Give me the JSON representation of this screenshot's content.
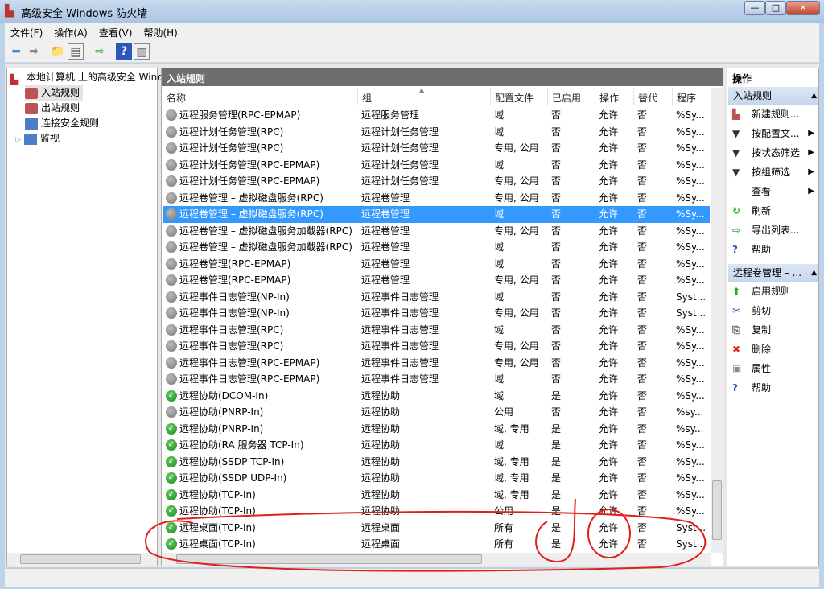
{
  "window": {
    "title": "高级安全 Windows 防火墙",
    "min": "—",
    "max": "□",
    "close": "✕"
  },
  "menu": [
    "文件(F)",
    "操作(A)",
    "查看(V)",
    "帮助(H)"
  ],
  "tree": {
    "root": "本地计算机 上的高级安全 Windows",
    "items": [
      "入站规则",
      "出站规则",
      "连接安全规则",
      "监视"
    ]
  },
  "center": {
    "title": "入站规则",
    "columns": [
      "名称",
      "组",
      "配置文件",
      "已启用",
      "操作",
      "替代",
      "程序"
    ],
    "rows": [
      [
        "远程服务管理(RPC-EPMAP)",
        "远程服务管理",
        "域",
        "否",
        "允许",
        "否",
        "%Sy...",
        false
      ],
      [
        "远程计划任务管理(RPC)",
        "远程计划任务管理",
        "域",
        "否",
        "允许",
        "否",
        "%Sy...",
        false
      ],
      [
        "远程计划任务管理(RPC)",
        "远程计划任务管理",
        "专用, 公用",
        "否",
        "允许",
        "否",
        "%Sy...",
        false
      ],
      [
        "远程计划任务管理(RPC-EPMAP)",
        "远程计划任务管理",
        "域",
        "否",
        "允许",
        "否",
        "%Sy...",
        false
      ],
      [
        "远程计划任务管理(RPC-EPMAP)",
        "远程计划任务管理",
        "专用, 公用",
        "否",
        "允许",
        "否",
        "%Sy...",
        false
      ],
      [
        "远程卷管理 – 虚拟磁盘服务(RPC)",
        "远程卷管理",
        "专用, 公用",
        "否",
        "允许",
        "否",
        "%Sy...",
        false
      ],
      [
        "远程卷管理 – 虚拟磁盘服务(RPC)",
        "远程卷管理",
        "域",
        "否",
        "允许",
        "否",
        "%Sy...",
        false
      ],
      [
        "远程卷管理 – 虚拟磁盘服务加载器(RPC)",
        "远程卷管理",
        "专用, 公用",
        "否",
        "允许",
        "否",
        "%Sy...",
        false
      ],
      [
        "远程卷管理 – 虚拟磁盘服务加载器(RPC)",
        "远程卷管理",
        "域",
        "否",
        "允许",
        "否",
        "%Sy...",
        false
      ],
      [
        "远程卷管理(RPC-EPMAP)",
        "远程卷管理",
        "域",
        "否",
        "允许",
        "否",
        "%Sy...",
        false
      ],
      [
        "远程卷管理(RPC-EPMAP)",
        "远程卷管理",
        "专用, 公用",
        "否",
        "允许",
        "否",
        "%Sy...",
        false
      ],
      [
        "远程事件日志管理(NP-In)",
        "远程事件日志管理",
        "域",
        "否",
        "允许",
        "否",
        "Syst...",
        false
      ],
      [
        "远程事件日志管理(NP-In)",
        "远程事件日志管理",
        "专用, 公用",
        "否",
        "允许",
        "否",
        "Syst...",
        false
      ],
      [
        "远程事件日志管理(RPC)",
        "远程事件日志管理",
        "域",
        "否",
        "允许",
        "否",
        "%Sy...",
        false
      ],
      [
        "远程事件日志管理(RPC)",
        "远程事件日志管理",
        "专用, 公用",
        "否",
        "允许",
        "否",
        "%Sy...",
        false
      ],
      [
        "远程事件日志管理(RPC-EPMAP)",
        "远程事件日志管理",
        "专用, 公用",
        "否",
        "允许",
        "否",
        "%Sy...",
        false
      ],
      [
        "远程事件日志管理(RPC-EPMAP)",
        "远程事件日志管理",
        "域",
        "否",
        "允许",
        "否",
        "%Sy...",
        false
      ],
      [
        "远程协助(DCOM-In)",
        "远程协助",
        "域",
        "是",
        "允许",
        "否",
        "%Sy...",
        true
      ],
      [
        "远程协助(PNRP-In)",
        "远程协助",
        "公用",
        "否",
        "允许",
        "否",
        "%sy...",
        false
      ],
      [
        "远程协助(PNRP-In)",
        "远程协助",
        "域, 专用",
        "是",
        "允许",
        "否",
        "%sy...",
        true
      ],
      [
        "远程协助(RA 服务器 TCP-In)",
        "远程协助",
        "域",
        "是",
        "允许",
        "否",
        "%Sy...",
        true
      ],
      [
        "远程协助(SSDP TCP-In)",
        "远程协助",
        "域, 专用",
        "是",
        "允许",
        "否",
        "%Sy...",
        true
      ],
      [
        "远程协助(SSDP UDP-In)",
        "远程协助",
        "域, 专用",
        "是",
        "允许",
        "否",
        "%Sy...",
        true
      ],
      [
        "远程协助(TCP-In)",
        "远程协助",
        "域, 专用",
        "是",
        "允许",
        "否",
        "%Sy...",
        true
      ],
      [
        "远程协助(TCP-In)",
        "远程协助",
        "公用",
        "是",
        "允许",
        "否",
        "%Sy...",
        true
      ],
      [
        "远程桌面(TCP-In)",
        "远程桌面",
        "所有",
        "是",
        "允许",
        "否",
        "Syst...",
        true
      ],
      [
        "远程桌面(TCP-In)",
        "远程桌面",
        "所有",
        "是",
        "允许",
        "否",
        "Syst...",
        true
      ]
    ],
    "selected_row": 6
  },
  "actions": {
    "title": "操作",
    "section1": "入站规则",
    "items1": [
      "新建规则...",
      "按配置文...",
      "按状态筛选",
      "按组筛选",
      "查看",
      "刷新",
      "导出列表...",
      "帮助"
    ],
    "section2": "远程卷管理 – ...",
    "items2": [
      "启用规则",
      "剪切",
      "复制",
      "删除",
      "属性",
      "帮助"
    ]
  },
  "colors": {
    "selection": "#3399ff",
    "annotation": "#e0201c",
    "title_bar": "#6e6e6e"
  }
}
